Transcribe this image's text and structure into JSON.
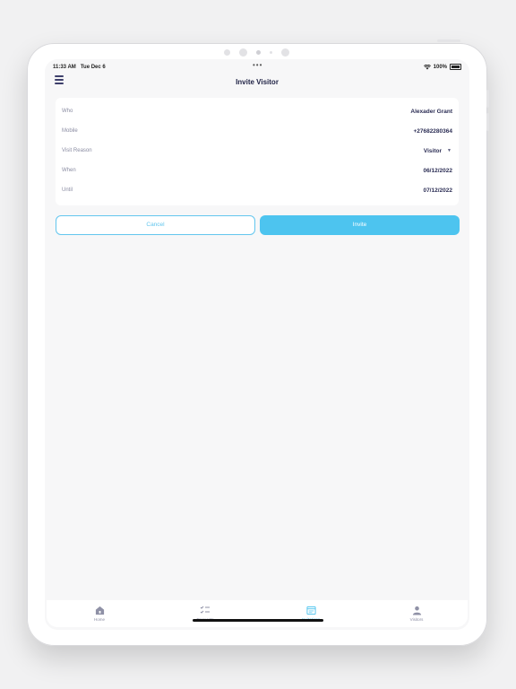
{
  "status_bar": {
    "time": "11:33 AM",
    "date": "Tue Dec 6",
    "battery": "100%",
    "multitask_dots": "•••"
  },
  "header": {
    "title": "Invite Visitor",
    "menu_icon": "stack-icon"
  },
  "form": {
    "rows": [
      {
        "label": "Who",
        "value": "Alexader Grant"
      },
      {
        "label": "Mobile",
        "value": "+27682280364"
      },
      {
        "label": "Visit Reason",
        "value": "Visitor",
        "dropdown": true
      },
      {
        "label": "When",
        "value": "06/12/2022"
      },
      {
        "label": "Until",
        "value": "07/12/2022"
      }
    ]
  },
  "actions": {
    "cancel_label": "Cancel",
    "invite_label": "Invite"
  },
  "tabs": [
    {
      "label": "Home",
      "icon": "home-icon"
    },
    {
      "label": "Requests",
      "icon": "checklist-icon"
    },
    {
      "label": "Invitations",
      "icon": "invitation-icon",
      "active": true
    },
    {
      "label": "Visitors",
      "icon": "person-icon"
    }
  ],
  "colors": {
    "accent": "#4dc4ef",
    "text_dark": "#2c2e55",
    "label": "#8a8ca2"
  }
}
